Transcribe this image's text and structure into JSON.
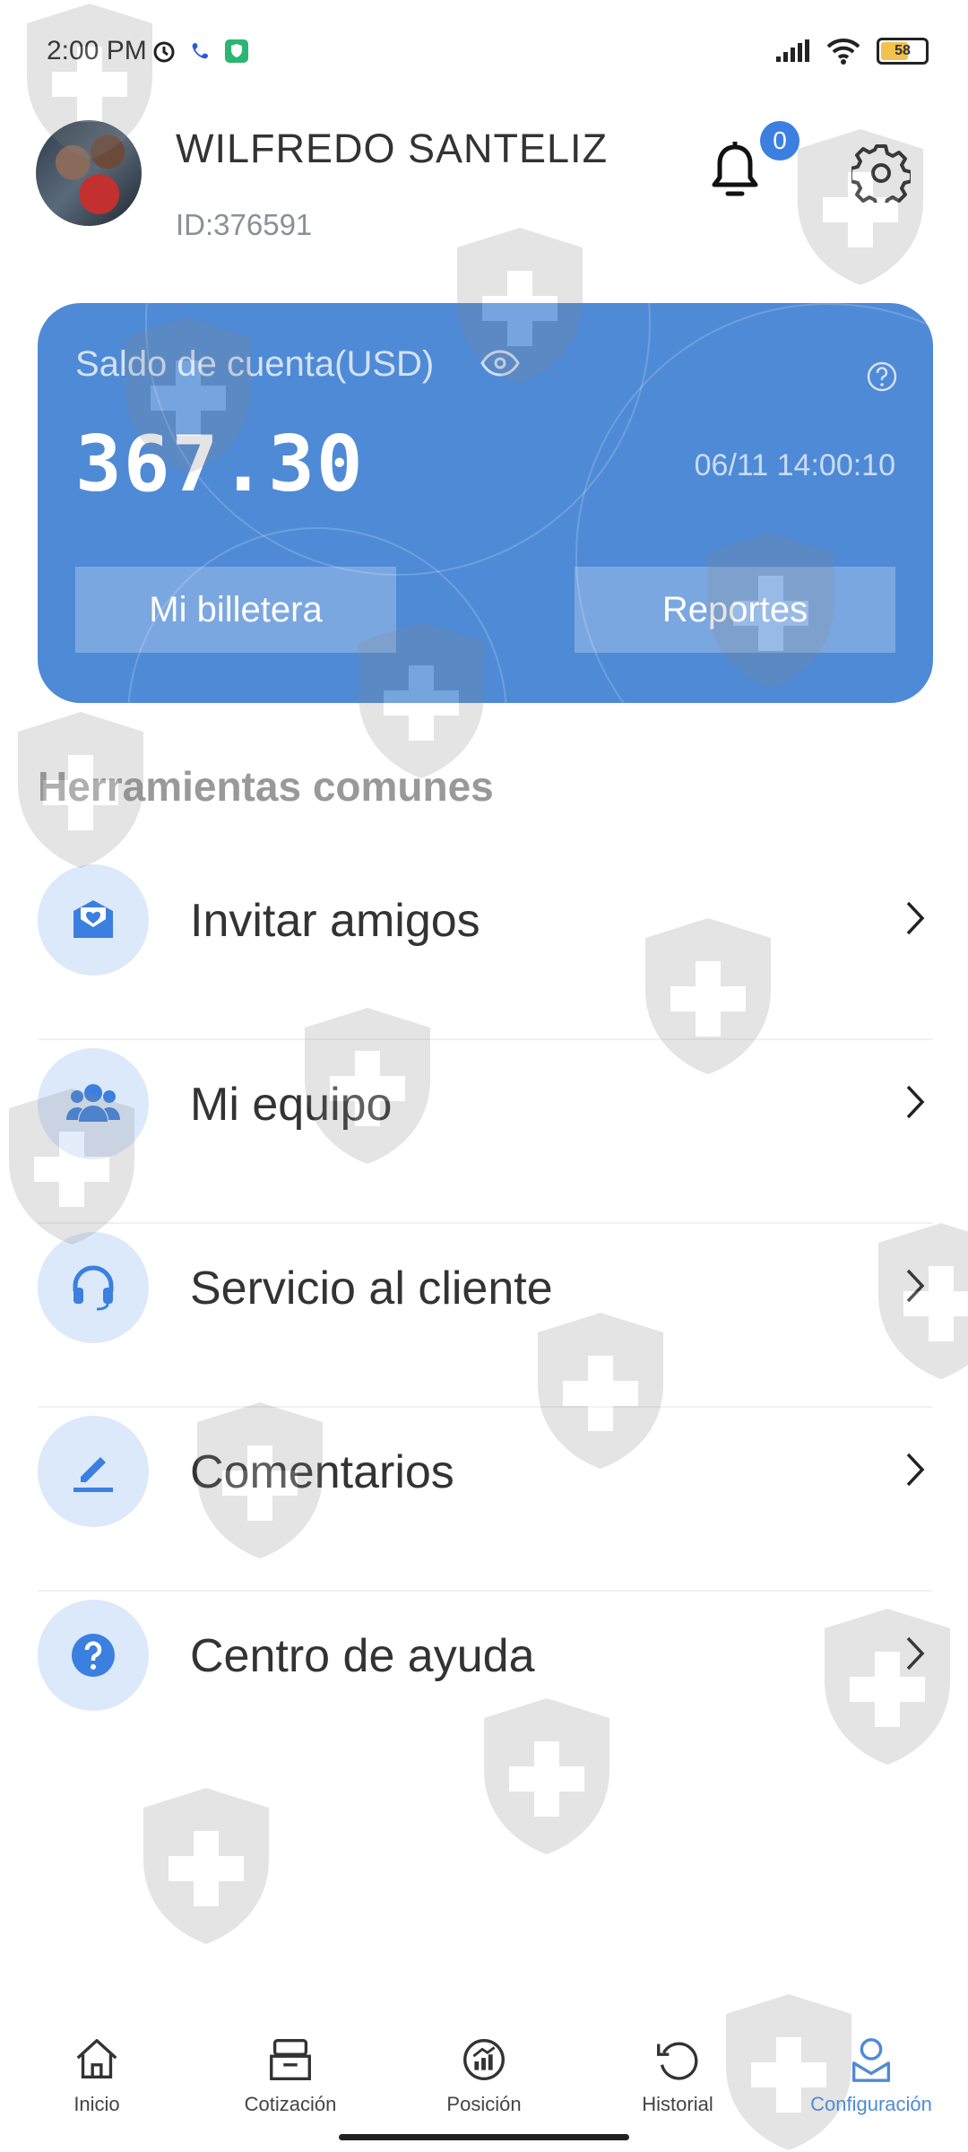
{
  "status_bar": {
    "time": "2:00 PM",
    "battery_level": "58"
  },
  "header": {
    "user_name": "WILFREDO SANTELIZ",
    "user_id": "ID:376591",
    "notification_count": "0"
  },
  "balance_card": {
    "label": "Saldo de cuenta(USD)",
    "amount": "367.30",
    "timestamp": "06/11 14:00:10",
    "wallet_button": "Mi billetera",
    "reports_button": "Reportes",
    "card_color": "#4f8ad6"
  },
  "tools": {
    "section_title": "Herramientas comunes",
    "items": [
      {
        "label": "Invitar amigos",
        "icon": "envelope-heart-icon"
      },
      {
        "label": "Mi equipo",
        "icon": "team-icon"
      },
      {
        "label": "Servicio al cliente",
        "icon": "headset-icon"
      },
      {
        "label": "Comentarios",
        "icon": "pencil-icon"
      },
      {
        "label": "Centro de ayuda",
        "icon": "question-icon"
      }
    ]
  },
  "bottom_nav": {
    "items": [
      {
        "label": "Inicio",
        "icon": "home-icon"
      },
      {
        "label": "Cotización",
        "icon": "quote-icon"
      },
      {
        "label": "Posición",
        "icon": "position-icon"
      },
      {
        "label": "Historial",
        "icon": "history-icon"
      },
      {
        "label": "Configuración",
        "icon": "profile-icon",
        "active": true
      }
    ],
    "active_color": "#4f8ad6"
  }
}
